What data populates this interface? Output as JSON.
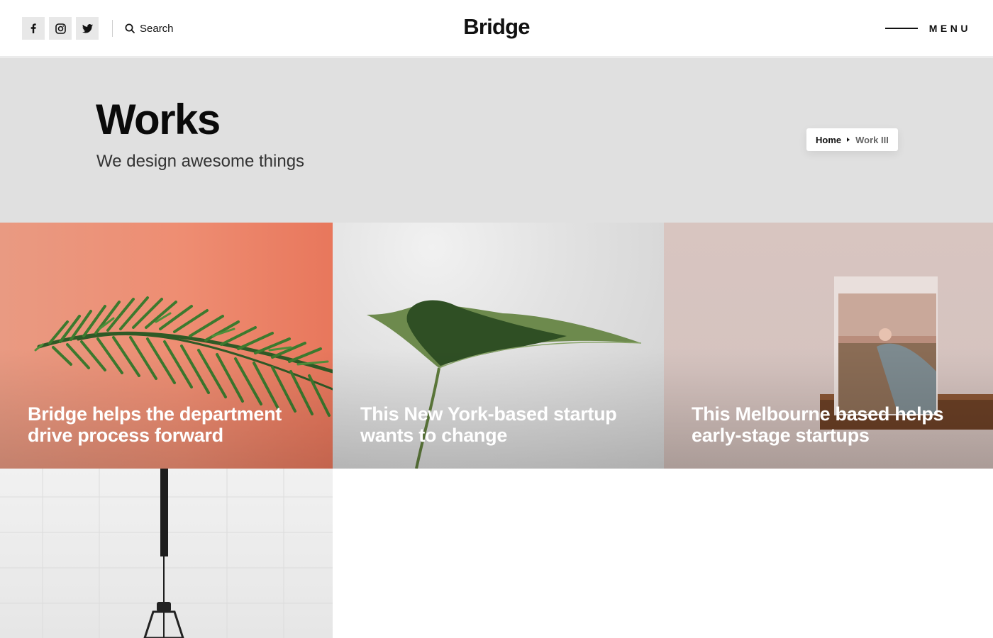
{
  "header": {
    "logo": "Bridge",
    "social": [
      {
        "name": "facebook",
        "icon": "facebook-icon"
      },
      {
        "name": "instagram",
        "icon": "instagram-icon"
      },
      {
        "name": "twitter",
        "icon": "twitter-icon"
      }
    ],
    "search_label": "Search",
    "menu_label": "MENU"
  },
  "title_band": {
    "title": "Works",
    "subtitle": "We design awesome things",
    "breadcrumb": {
      "home": "Home",
      "current": "Work III"
    }
  },
  "portfolio": {
    "items": [
      {
        "title": "Bridge helps the department drive process forward",
        "image": "coral-pine-branch"
      },
      {
        "title": "This New York-based startup wants to change",
        "image": "green-leaf-stem"
      },
      {
        "title": "This Melbourne based helps early-stage startups",
        "image": "photo-print-on-shelf"
      },
      {
        "title": "",
        "image": "pendant-lamp-tile-wall"
      }
    ]
  },
  "colors": {
    "band_bg": "#e0e0e0",
    "social_bg": "#e8e8e8",
    "text": "#111111"
  }
}
